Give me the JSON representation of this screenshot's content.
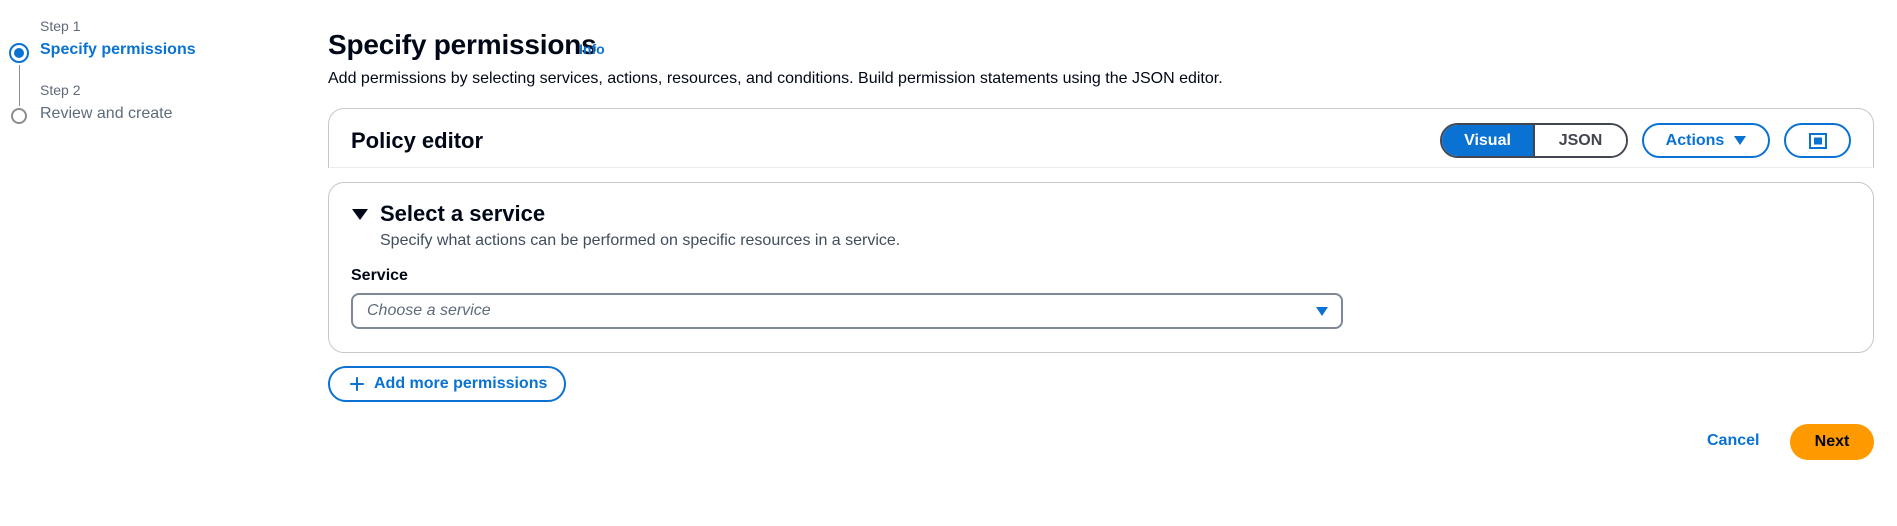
{
  "stepper": {
    "steps": [
      {
        "meta": "Step 1",
        "title": "Specify permissions",
        "active": true
      },
      {
        "meta": "Step 2",
        "title": "Review and create",
        "active": false
      }
    ]
  },
  "header": {
    "title": "Specify permissions",
    "info_label": "Info",
    "description": "Add permissions by selecting services, actions, resources, and conditions. Build permission statements using the JSON editor."
  },
  "policy_editor": {
    "title": "Policy editor",
    "modes": [
      "Visual",
      "JSON"
    ],
    "selected_mode": "Visual",
    "actions_label": "Actions",
    "fullscreen_icon": "fullscreen-icon"
  },
  "service_section": {
    "title": "Select a service",
    "description": "Specify what actions can be performed on specific resources in a service.",
    "field_label": "Service",
    "placeholder": "Choose a service"
  },
  "add_permissions_label": "Add more permissions",
  "footer": {
    "cancel_label": "Cancel",
    "next_label": "Next"
  },
  "colors": {
    "accent": "#0972d3",
    "primary_button": "#ff9900",
    "text": "#000716",
    "muted": "#5f6b7a"
  }
}
